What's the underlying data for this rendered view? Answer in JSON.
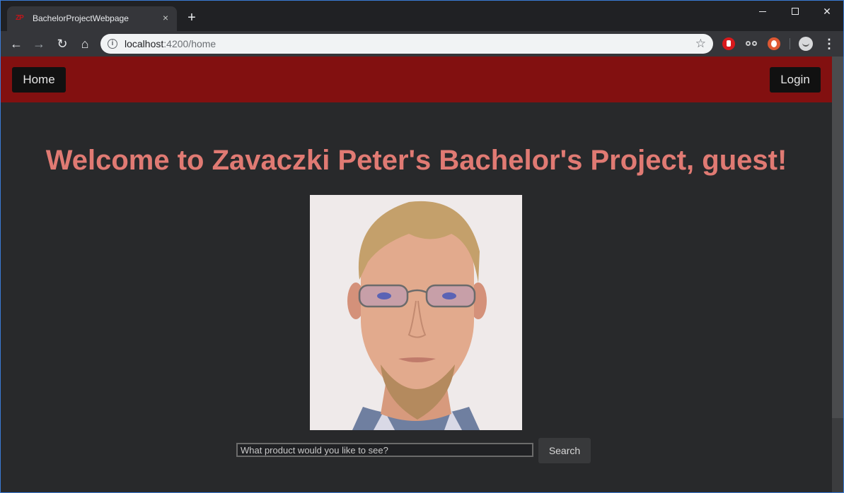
{
  "browser": {
    "tab": {
      "title": "BachelorProjectWebpage",
      "favicon": "ZP",
      "close_icon": "×"
    },
    "new_tab_icon": "+",
    "address": {
      "host": "localhost",
      "path": ":4200/home"
    }
  },
  "page": {
    "nav": {
      "home_label": "Home",
      "login_label": "Login"
    },
    "welcome": "Welcome to Zavaczki Peter's Bachelor's Project, guest!",
    "search": {
      "placeholder": "What product would you like to see?",
      "button_label": "Search"
    }
  },
  "colors": {
    "navbar_bg": "#821010",
    "heading": "#e07a73",
    "page_bg": "#28292b"
  }
}
